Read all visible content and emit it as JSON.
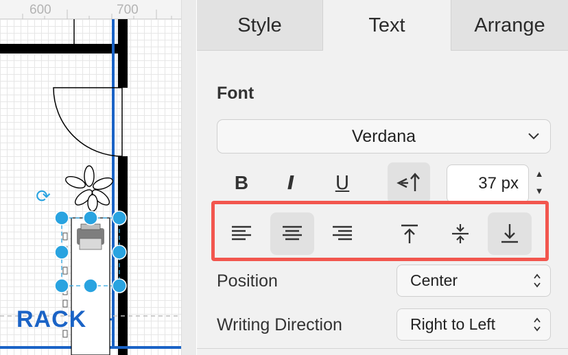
{
  "ruler": {
    "marks": [
      "600",
      "700"
    ]
  },
  "canvas": {
    "rack_label": "RACK",
    "rotate_icon": "rotate-icon"
  },
  "tabs": [
    {
      "label": "Style"
    },
    {
      "label": "Text"
    },
    {
      "label": "Arrange"
    }
  ],
  "active_tab": "Text",
  "font": {
    "heading": "Font",
    "family": "Verdana",
    "bold_label": "B",
    "italic_label": "I",
    "underline_label": "U",
    "size_value": "37 px"
  },
  "alignment": {
    "horizontal_active": "center",
    "vertical_active": "bottom"
  },
  "position": {
    "label": "Position",
    "value": "Center"
  },
  "writing_direction": {
    "label": "Writing Direction",
    "value": "Right to Left"
  },
  "colors": {
    "highlight_frame": "#f2564e",
    "selection_handle": "#29a3e0",
    "wall_blue": "#1a63c6"
  }
}
